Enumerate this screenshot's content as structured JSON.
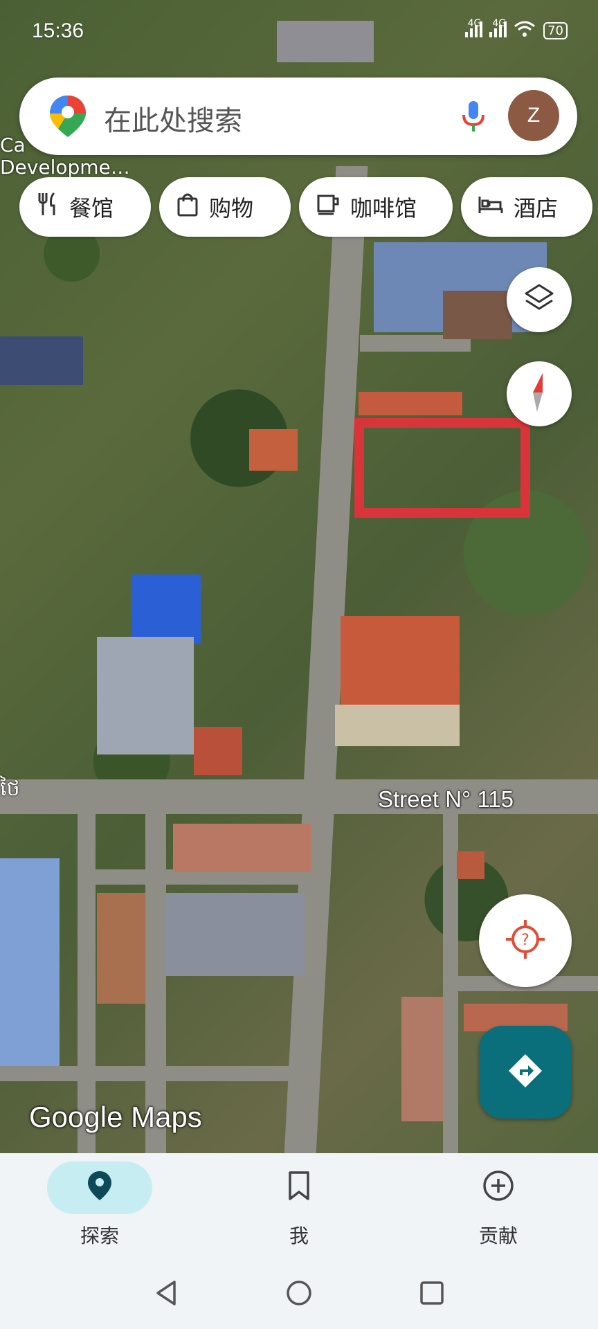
{
  "status_bar": {
    "time": "15:36",
    "network_1": "4G",
    "network_2": "4G",
    "battery": "70"
  },
  "search": {
    "placeholder": "在此处搜索",
    "avatar_letter": "Z"
  },
  "chips": [
    {
      "label": "餐馆",
      "icon": "restaurant-icon"
    },
    {
      "label": "购物",
      "icon": "shopping-bag-icon"
    },
    {
      "label": "咖啡馆",
      "icon": "coffee-cup-icon"
    },
    {
      "label": "酒店",
      "icon": "bed-icon"
    }
  ],
  "map": {
    "place_label_line1": "Ca",
    "place_label_line2": "Developme…",
    "street_label": "Street N° 115",
    "edge_label": "ថៃ",
    "watermark": "Google Maps"
  },
  "controls": {
    "layers_icon": "layers-icon",
    "compass_icon": "compass-icon",
    "location_icon": "my-location-icon",
    "directions_icon": "directions-icon",
    "highlight_color": "#d9343a",
    "directions_color": "#0b6e7b"
  },
  "bottom_nav": {
    "items": [
      {
        "label": "探索",
        "icon": "location-pin-icon",
        "active": true
      },
      {
        "label": "我",
        "icon": "bookmark-icon",
        "active": false
      },
      {
        "label": "贡献",
        "icon": "add-circle-icon",
        "active": false
      }
    ]
  },
  "system_nav": {
    "back_icon": "back-triangle-icon",
    "home_icon": "home-circle-icon",
    "recents_icon": "recents-square-icon"
  }
}
